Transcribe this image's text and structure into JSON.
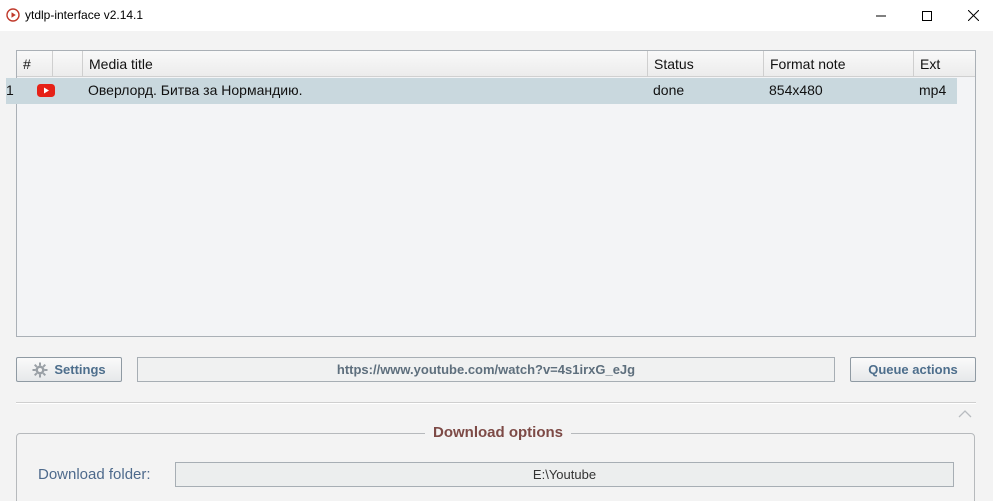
{
  "window": {
    "title": "ytdlp-interface v2.14.1",
    "icon": "play-circle-icon",
    "accent": "#c0392b"
  },
  "table": {
    "headers": [
      "#",
      "",
      "Media title",
      "Status",
      "Format note",
      "Ext"
    ],
    "rows": [
      {
        "num": "1",
        "source_icon": "youtube-icon",
        "title": "Оверлорд. Битва за Нормандию.",
        "status": "done",
        "format_note": "854x480",
        "ext": "mp4"
      }
    ],
    "selected_row_color": "#c9d8de"
  },
  "toolbar": {
    "settings_label": "Settings",
    "settings_icon": "gear-icon",
    "url_value": "https://www.youtube.com/watch?v=4s1irxG_eJg",
    "queue_label": "Queue actions"
  },
  "download_options": {
    "title": "Download options",
    "folder_label": "Download folder:",
    "folder_value": "E:\\Youtube"
  }
}
